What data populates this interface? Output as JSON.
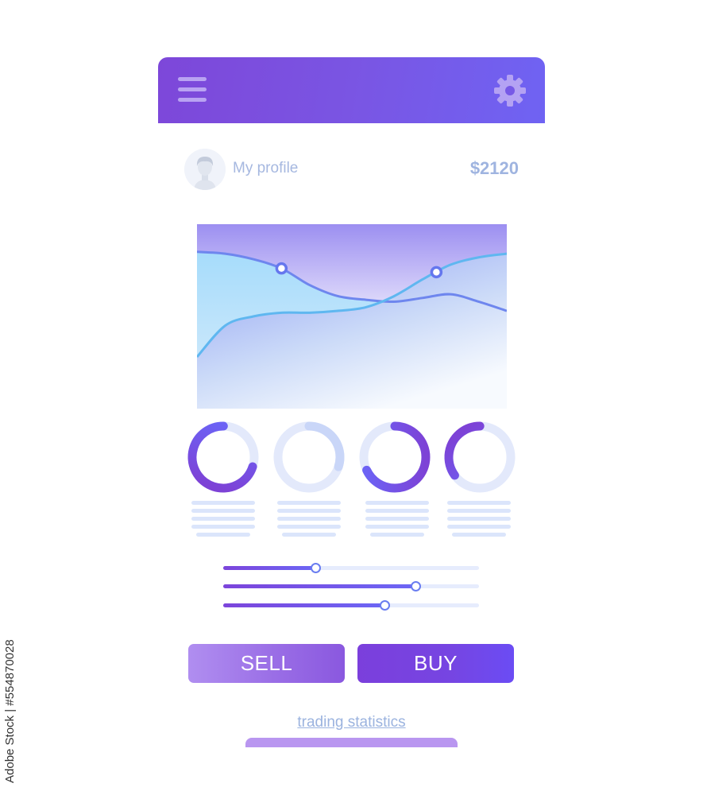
{
  "header": {
    "menu_icon": "hamburger-menu-icon",
    "settings_icon": "gear-icon",
    "colors": {
      "start": "#7d47d9",
      "end": "#6f63f3"
    }
  },
  "profile": {
    "label": "My profile",
    "avatar_icon": "user-avatar-icon",
    "balance": "$2120"
  },
  "chart_data": {
    "type": "area",
    "title": "",
    "xlabel": "",
    "ylabel": "",
    "grid": true,
    "x": [
      0,
      1,
      2,
      3,
      4,
      5,
      6,
      7,
      8,
      9,
      10,
      11
    ],
    "ylim": [
      0,
      100
    ],
    "series": [
      {
        "name": "series-a",
        "color": "#6e86ee",
        "values": [
          85,
          84,
          81,
          76,
          67,
          61,
          59,
          58,
          60,
          62,
          58,
          53
        ],
        "marker_index": 3
      },
      {
        "name": "series-b",
        "color": "#5fb7f0",
        "values": [
          28,
          45,
          50,
          52,
          52,
          53,
          55,
          61,
          70,
          78,
          82,
          84
        ],
        "marker_index": 8.5
      }
    ]
  },
  "donuts": [
    {
      "name": "donut-1",
      "value": 0.7,
      "start": 0.0,
      "active": true
    },
    {
      "name": "donut-2",
      "value": 0.3,
      "start": 0.0,
      "active": false
    },
    {
      "name": "donut-3",
      "value": 0.68,
      "start": 0.03,
      "active": true
    },
    {
      "name": "donut-4",
      "value": 0.35,
      "start": 0.0,
      "active": true
    }
  ],
  "sliders": [
    {
      "name": "slider-1",
      "value": 0.36
    },
    {
      "name": "slider-2",
      "value": 0.75
    },
    {
      "name": "slider-3",
      "value": 0.63
    }
  ],
  "actions": {
    "sell_label": "SELL",
    "buy_label": "BUY",
    "stats_link": "trading statistics"
  },
  "credit": "Adobe Stock | #554870028"
}
